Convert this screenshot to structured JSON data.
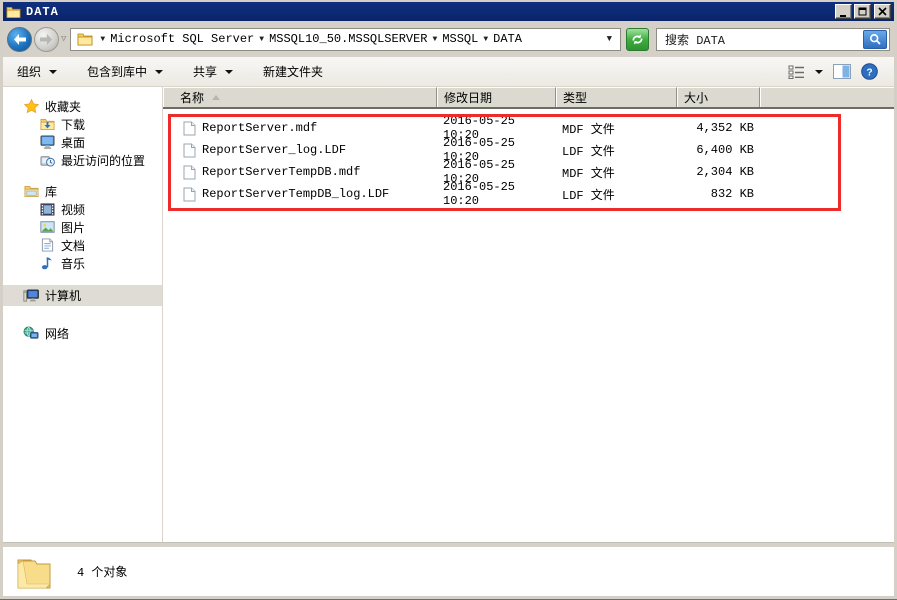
{
  "window": {
    "title": "DATA"
  },
  "titlebar": {
    "minimize": "minimize",
    "maximize": "maximize",
    "close": "close"
  },
  "address": {
    "breadcrumb": [
      "Microsoft SQL Server",
      "MSSQL10_50.MSSQLSERVER",
      "MSSQL",
      "DATA"
    ],
    "search_text": "搜索 DATA"
  },
  "toolbar": {
    "items": [
      "组织",
      "包含到库中",
      "共享",
      "新建文件夹"
    ],
    "dropdown_items": [
      true,
      true,
      true,
      false
    ]
  },
  "columns": [
    "名称",
    "修改日期",
    "类型",
    "大小"
  ],
  "files": [
    {
      "name": "ReportServer.mdf",
      "date": "2016-05-25 10:20",
      "type": "MDF 文件",
      "size": "4,352 KB"
    },
    {
      "name": "ReportServer_log.LDF",
      "date": "2016-05-25 10:20",
      "type": "LDF 文件",
      "size": "6,400 KB"
    },
    {
      "name": "ReportServerTempDB.mdf",
      "date": "2016-05-25 10:20",
      "type": "MDF 文件",
      "size": "2,304 KB"
    },
    {
      "name": "ReportServerTempDB_log.LDF",
      "date": "2016-05-25 10:20",
      "type": "LDF 文件",
      "size": "832 KB"
    }
  ],
  "sidebar": {
    "groups": [
      {
        "label": "收藏夹",
        "icon": "star-icon",
        "items": [
          {
            "label": "下载",
            "icon": "download-folder-icon"
          },
          {
            "label": "桌面",
            "icon": "desktop-icon"
          },
          {
            "label": "最近访问的位置",
            "icon": "recent-places-icon"
          }
        ]
      },
      {
        "label": "库",
        "icon": "library-icon",
        "items": [
          {
            "label": "视频",
            "icon": "video-icon"
          },
          {
            "label": "图片",
            "icon": "picture-icon"
          },
          {
            "label": "文档",
            "icon": "document-icon"
          },
          {
            "label": "音乐",
            "icon": "music-icon"
          }
        ]
      },
      {
        "label": "计算机",
        "icon": "computer-icon",
        "selected": true,
        "items": []
      },
      {
        "label": "网络",
        "icon": "network-icon",
        "items": []
      }
    ]
  },
  "status": {
    "text": "4  个对象"
  },
  "colors": {
    "titlebar": "#0A246A",
    "annotation_red": "#EE2B2B",
    "refresh_green": "#3FAE3F",
    "search_blue": "#2F6FC0",
    "chrome_gray": "#D4D0C8"
  }
}
